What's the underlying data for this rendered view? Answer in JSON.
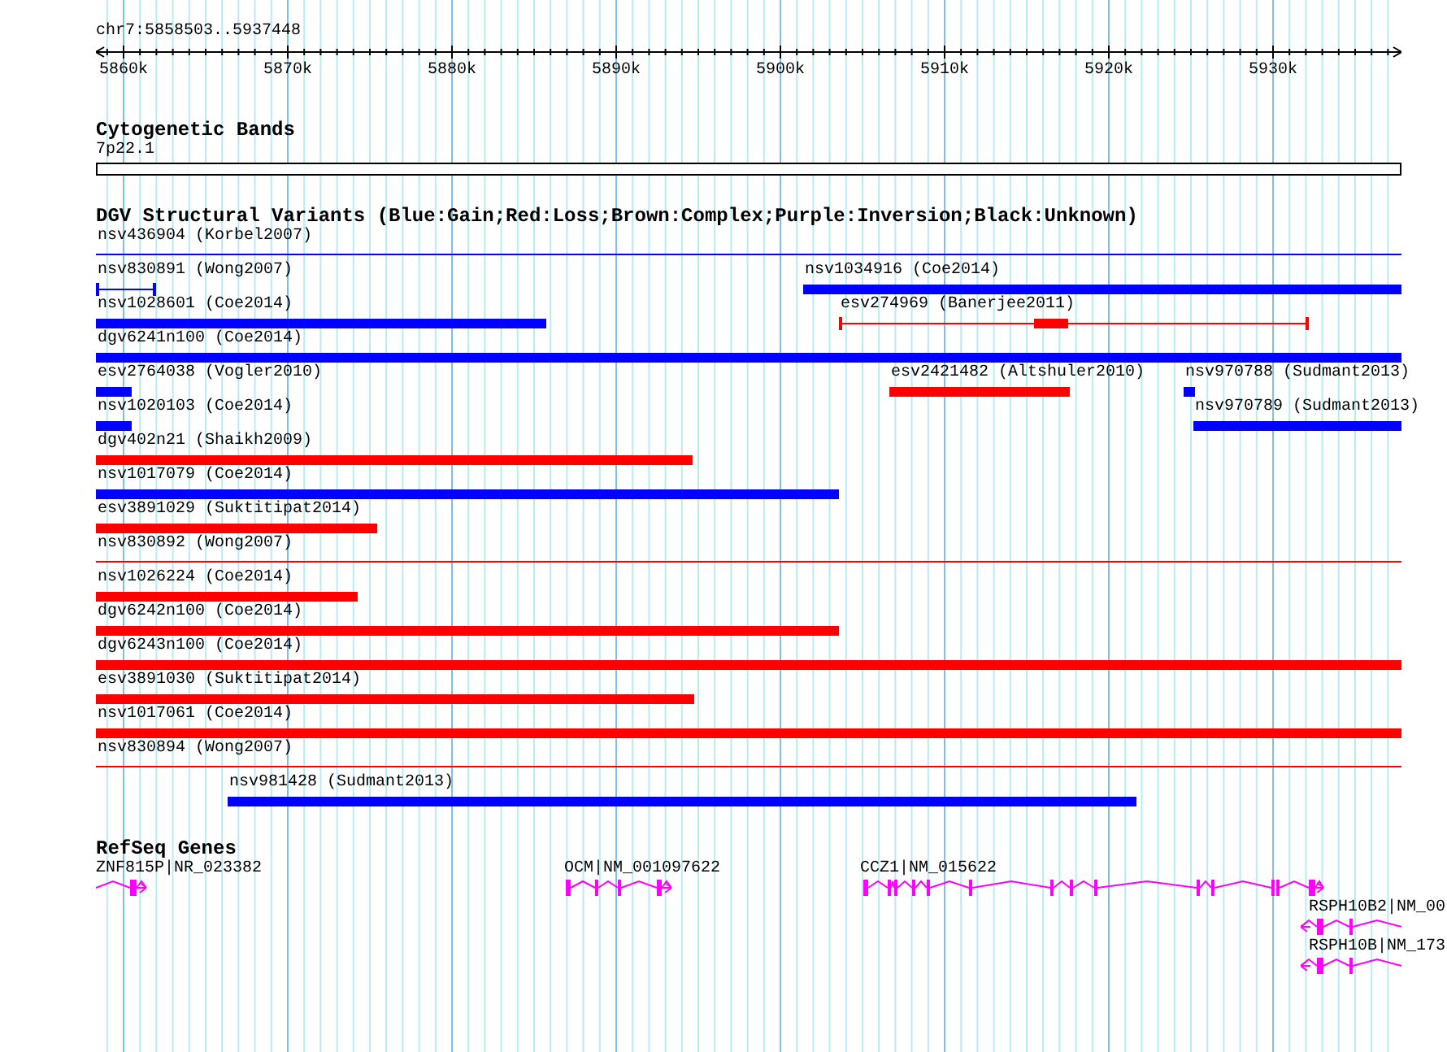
{
  "location": "chr7:5858503..5937448",
  "ruler": {
    "ticks": [
      "5860k",
      "5870k",
      "5880k",
      "5890k",
      "5900k",
      "5910k",
      "5920k",
      "5930k"
    ]
  },
  "cytoband_track": {
    "title": "Cytogenetic Bands",
    "band": {
      "label": "7p22.1"
    }
  },
  "variant_track": {
    "title": "DGV Structural Variants (Blue:Gain;Red:Loss;Brown:Complex;Purple:Inversion;Black:Unknown)",
    "rows": [
      {
        "features": [
          {
            "label": "nsv436904 (Korbel2007)",
            "kind": "line",
            "color": "#0000ff"
          }
        ]
      },
      {
        "features": [
          {
            "label": "nsv830891 (Wong2007)",
            "kind": "capped",
            "color": "#0000ff"
          },
          {
            "label": "nsv1034916 (Coe2014)",
            "kind": "bar",
            "color": "#0000ff"
          }
        ]
      },
      {
        "features": [
          {
            "label": "nsv1028601 (Coe2014)",
            "kind": "bar",
            "color": "#0000ff"
          },
          {
            "label": "esv274969 (Banerjee2011)",
            "kind": "split",
            "color": "#ff0000"
          }
        ]
      },
      {
        "features": [
          {
            "label": "dgv6241n100 (Coe2014)",
            "kind": "bar",
            "color": "#0000ff"
          }
        ]
      },
      {
        "features": [
          {
            "label": "esv2764038 (Vogler2010)",
            "kind": "bar",
            "color": "#0000ff"
          },
          {
            "label": "esv2421482 (Altshuler2010)",
            "kind": "bar",
            "color": "#ff0000"
          },
          {
            "label": "nsv970788 (Sudmant2013)",
            "kind": "bar",
            "color": "#0000ff"
          }
        ]
      },
      {
        "features": [
          {
            "label": "nsv1020103 (Coe2014)",
            "kind": "bar",
            "color": "#0000ff"
          },
          {
            "label": "nsv970789 (Sudmant2013)",
            "kind": "bar",
            "color": "#0000ff"
          }
        ]
      },
      {
        "features": [
          {
            "label": "dgv402n21 (Shaikh2009)",
            "kind": "bar",
            "color": "#ff0000"
          }
        ]
      },
      {
        "features": [
          {
            "label": "nsv1017079 (Coe2014)",
            "kind": "bar",
            "color": "#0000ff"
          }
        ]
      },
      {
        "features": [
          {
            "label": "esv3891029 (Suktitipat2014)",
            "kind": "bar",
            "color": "#ff0000"
          }
        ]
      },
      {
        "features": [
          {
            "label": "nsv830892 (Wong2007)",
            "kind": "line",
            "color": "#ff0000"
          }
        ]
      },
      {
        "features": [
          {
            "label": "nsv1026224 (Coe2014)",
            "kind": "bar",
            "color": "#ff0000"
          }
        ]
      },
      {
        "features": [
          {
            "label": "dgv6242n100 (Coe2014)",
            "kind": "bar",
            "color": "#ff0000"
          }
        ]
      },
      {
        "features": [
          {
            "label": "dgv6243n100 (Coe2014)",
            "kind": "bar",
            "color": "#ff0000"
          }
        ]
      },
      {
        "features": [
          {
            "label": "esv3891030 (Suktitipat2014)",
            "kind": "bar",
            "color": "#ff0000"
          }
        ]
      },
      {
        "features": [
          {
            "label": "nsv1017061 (Coe2014)",
            "kind": "bar",
            "color": "#ff0000"
          }
        ]
      },
      {
        "features": [
          {
            "label": "nsv830894 (Wong2007)",
            "kind": "line",
            "color": "#ff0000"
          }
        ]
      },
      {
        "features": [
          {
            "label": "nsv981428 (Sudmant2013)",
            "kind": "bar",
            "color": "#0000ff"
          }
        ]
      }
    ]
  },
  "gene_track": {
    "title": "RefSeq Genes",
    "rows": [
      {
        "genes": [
          {
            "label": "ZNF815P|NR_023382",
            "reverse": false
          },
          {
            "label": "OCM|NM_001097622",
            "reverse": false
          },
          {
            "label": "CCZ1|NM_015622",
            "reverse": false
          }
        ]
      },
      {
        "genes": [
          {
            "label": "RSPH10B2|NM_00",
            "reverse": true
          }
        ]
      },
      {
        "genes": [
          {
            "label": "RSPH10B|NM_173",
            "reverse": true
          }
        ]
      }
    ]
  }
}
